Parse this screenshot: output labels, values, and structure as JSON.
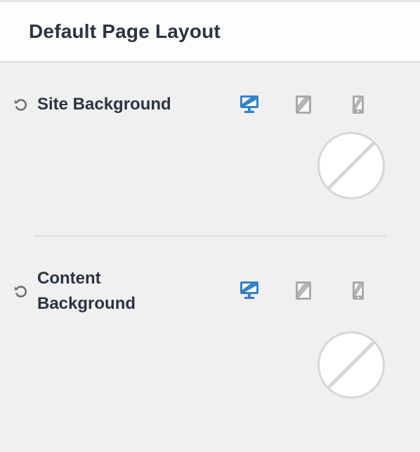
{
  "header": {
    "title": "Default Page Layout"
  },
  "sections": [
    {
      "label": "Site Background",
      "devices": {
        "desktop": {
          "icon": "desktop-icon",
          "active": true
        },
        "tablet": {
          "icon": "tablet-icon",
          "active": false
        },
        "mobile": {
          "icon": "mobile-icon",
          "active": false
        }
      },
      "color": "none"
    },
    {
      "label_line1": "Content",
      "label_line2": "Background",
      "devices": {
        "desktop": {
          "icon": "desktop-icon",
          "active": true
        },
        "tablet": {
          "icon": "tablet-icon",
          "active": false
        },
        "mobile": {
          "icon": "mobile-icon",
          "active": false
        }
      },
      "color": "none"
    }
  ],
  "colors": {
    "active_icon": "#3582c4",
    "inactive_icon": "#a7aaad",
    "text": "#2c3442",
    "background": "#f0f0f1"
  }
}
